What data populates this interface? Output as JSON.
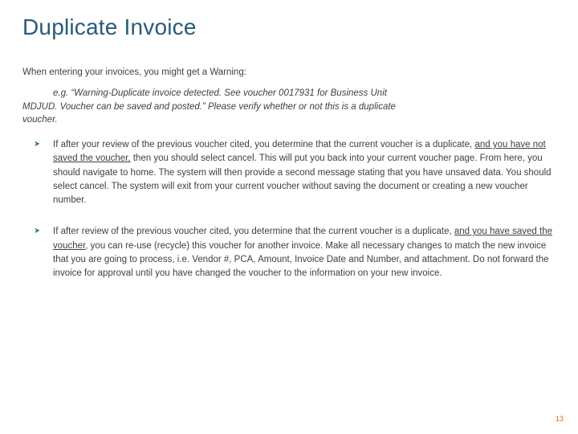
{
  "title": "Duplicate Invoice",
  "intro": "When entering your invoices, you might get a Warning:",
  "example": {
    "lead": "e.g. “Warning-Duplicate invoice detected.  See voucher 0017931 for Business Unit",
    "rest": "MDJUD. Voucher can be saved and posted.” Please verify whether or not this is a duplicate",
    "last": "voucher."
  },
  "bullets": [
    {
      "pre": "If after your review of the previous voucher cited, you determine that the current voucher is a duplicate, ",
      "underlined": "and you have not saved the voucher,",
      "post": " then you should select cancel.  This will put you back into your current voucher page.  From here, you should navigate to home.  The system will then provide a second message stating that you have unsaved data.  You should select cancel.  The system will exit from your current voucher without saving the document or creating a new voucher number."
    },
    {
      "pre": "If after review of the previous voucher cited, you determine that the current voucher is a duplicate, ",
      "underlined": "and you have saved the voucher,",
      "post": " you can re-use (recycle) this voucher for another invoice. Make all necessary changes to match the new invoice that you are going to process, i.e. Vendor #, PCA, Amount, Invoice Date and Number, and attachment.  Do not forward the invoice for approval until you have changed the voucher to the information on your new invoice."
    }
  ],
  "pagenum": "13"
}
